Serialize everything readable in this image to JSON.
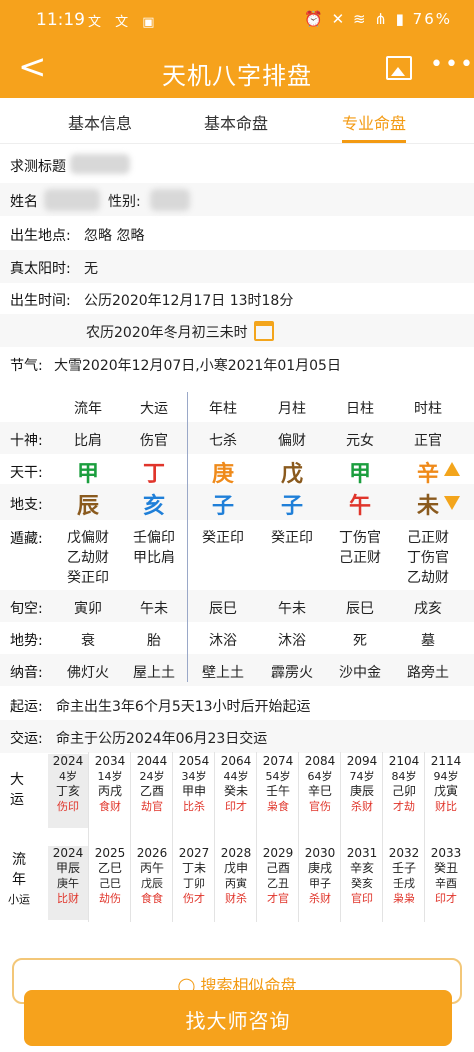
{
  "status": {
    "time": "11:19",
    "icons_left": "文 文 ▣",
    "battery": "76%",
    "right_icons": "⏰ ✕ ≋ ⋔ ▮"
  },
  "appbar": {
    "back": "<",
    "title": "天机八字排盘",
    "image_icon": "image-icon",
    "more": "•••"
  },
  "tabs": [
    "基本信息",
    "基本命盘",
    "专业命盘"
  ],
  "info": {
    "title_label": "求测标题",
    "name_label": "姓名",
    "gender_label": "性别:",
    "birthplace_label": "出生地点:",
    "birthplace_value": "忽略 忽略",
    "solar_label": "真太阳时:",
    "solar_value": "无",
    "birthtime_label": "出生时间:",
    "birthtime_value": "公历2020年12月17日 13时18分",
    "lunar_value": "农历2020年冬月初三未时",
    "jieqi_label": "节气:",
    "jieqi_value": "大雪2020年12月07日,小寒2021年01月05日"
  },
  "chart": {
    "headers": [
      "流年",
      "大运",
      "年柱",
      "月柱",
      "日柱",
      "时柱"
    ],
    "shishen_label": "十神:",
    "shishen": [
      "比肩",
      "伤官",
      "七杀",
      "偏财",
      "元女",
      "正官"
    ],
    "tiangan_label": "天干:",
    "tiangan": [
      "甲",
      "丁",
      "庚",
      "戊",
      "甲",
      "辛"
    ],
    "dizhi_label": "地支:",
    "dizhi": [
      "辰",
      "亥",
      "子",
      "子",
      "午",
      "未"
    ],
    "canggan_label": "遁藏:",
    "canggan": [
      [
        "戊偏财",
        "乙劫财",
        "癸正印"
      ],
      [
        "壬偏印",
        "甲比肩"
      ],
      [
        "癸正印"
      ],
      [
        "癸正印"
      ],
      [
        "丁伤官",
        "己正财"
      ],
      [
        "己正财",
        "丁伤官",
        "乙劫财"
      ]
    ],
    "xunkong_label": "旬空:",
    "xunkong": [
      "寅卯",
      "午未",
      "辰巳",
      "午未",
      "辰巳",
      "戌亥"
    ],
    "dishi_label": "地势:",
    "dishi": [
      "衰",
      "胎",
      "沐浴",
      "沐浴",
      "死",
      "墓"
    ],
    "nayin_label": "纳音:",
    "nayin": [
      "佛灯火",
      "屋上土",
      "壁上土",
      "霹雳火",
      "沙中金",
      "路旁土"
    ],
    "colors": {
      "wood": "#1b9e3e",
      "fire": "#e0352b",
      "metal": "#ef8a1a",
      "water": "#1f7fd8",
      "earth": "#8a5a1e",
      "accent": "#f6a21c"
    }
  },
  "qiyun": {
    "label": "起运:",
    "value": "命主出生3年6个月5天13小时后开始起运"
  },
  "jiaoyun": {
    "label": "交运:",
    "value": "命主于公历2024年06月23日交运"
  },
  "dayun": {
    "label_1": "大",
    "label_2": "运",
    "items": [
      {
        "year": "2024",
        "age": "4岁",
        "gz": "丁亥",
        "ss": "伤印"
      },
      {
        "year": "2034",
        "age": "14岁",
        "gz": "丙戌",
        "ss": "食财"
      },
      {
        "year": "2044",
        "age": "24岁",
        "gz": "乙酉",
        "ss": "劫官"
      },
      {
        "year": "2054",
        "age": "34岁",
        "gz": "甲申",
        "ss": "比杀"
      },
      {
        "year": "2064",
        "age": "44岁",
        "gz": "癸未",
        "ss": "印才"
      },
      {
        "year": "2074",
        "age": "54岁",
        "gz": "壬午",
        "ss": "枭食"
      },
      {
        "year": "2084",
        "age": "64岁",
        "gz": "辛巳",
        "ss": "官伤"
      },
      {
        "year": "2094",
        "age": "74岁",
        "gz": "庚辰",
        "ss": "杀财"
      },
      {
        "year": "2104",
        "age": "84岁",
        "gz": "己卯",
        "ss": "才劫"
      },
      {
        "year": "2114",
        "age": "94岁",
        "gz": "戊寅",
        "ss": "财比"
      }
    ]
  },
  "liunian": {
    "label_1": "流",
    "label_2": "年",
    "label_3": "小运",
    "items": [
      {
        "year": "2024",
        "gz": "甲辰",
        "xy": "庚午",
        "ss": "比财"
      },
      {
        "year": "2025",
        "gz": "乙巳",
        "xy": "己巳",
        "ss": "劫伤"
      },
      {
        "year": "2026",
        "gz": "丙午",
        "xy": "戊辰",
        "ss": "食食"
      },
      {
        "year": "2027",
        "gz": "丁未",
        "xy": "丁卯",
        "ss": "伤才"
      },
      {
        "year": "2028",
        "gz": "戊申",
        "xy": "丙寅",
        "ss": "财杀"
      },
      {
        "year": "2029",
        "gz": "己酉",
        "xy": "乙丑",
        "ss": "才官"
      },
      {
        "year": "2030",
        "gz": "庚戌",
        "xy": "甲子",
        "ss": "杀财"
      },
      {
        "year": "2031",
        "gz": "辛亥",
        "xy": "癸亥",
        "ss": "官印"
      },
      {
        "year": "2032",
        "gz": "壬子",
        "xy": "壬戌",
        "ss": "枭枭"
      },
      {
        "year": "2033",
        "gz": "癸丑",
        "xy": "辛酉",
        "ss": "印才"
      }
    ]
  },
  "search_label": "搜索相似命盘",
  "cta_label": "找大师咨询"
}
